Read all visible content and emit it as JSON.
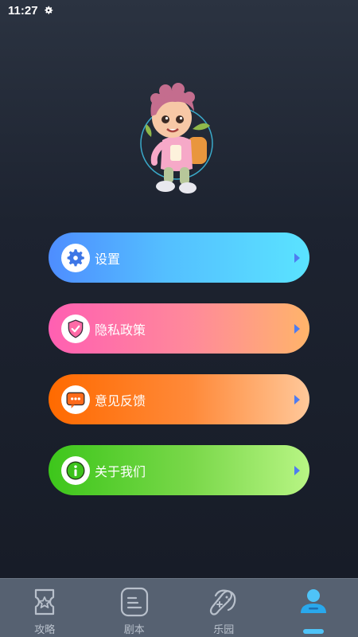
{
  "status_bar": {
    "time": "11:27",
    "icon": "gear-icon"
  },
  "avatar": {
    "name": "cartoon-kid-avatar"
  },
  "menu": [
    {
      "key": "settings",
      "label": "设置",
      "icon": "gear-icon",
      "color_start": "#4e8dff",
      "color_end": "#5ae3ff"
    },
    {
      "key": "privacy",
      "label": "隐私政策",
      "icon": "shield-check-icon",
      "color_start": "#ff5fb2",
      "color_end": "#ffb46a"
    },
    {
      "key": "feedback",
      "label": "意见反馈",
      "icon": "message-dots-icon",
      "color_start": "#ff6a00",
      "color_end": "#ffc89a"
    },
    {
      "key": "about",
      "label": "关于我们",
      "icon": "info-icon",
      "color_start": "#3dc61b",
      "color_end": "#b8f584"
    }
  ],
  "tabs": [
    {
      "label": "攻略",
      "icon": "ticket-star-icon",
      "active": false
    },
    {
      "label": "剧本",
      "icon": "document-lines-icon",
      "active": false
    },
    {
      "label": "乐园",
      "icon": "gamepad-icon",
      "active": false
    },
    {
      "label": "",
      "icon": "user-icon",
      "active": true
    }
  ],
  "colors": {
    "tab_active": "#4fc3f7",
    "tab_inactive": "#b8c0cb",
    "arrow": "#4e7cf0"
  }
}
